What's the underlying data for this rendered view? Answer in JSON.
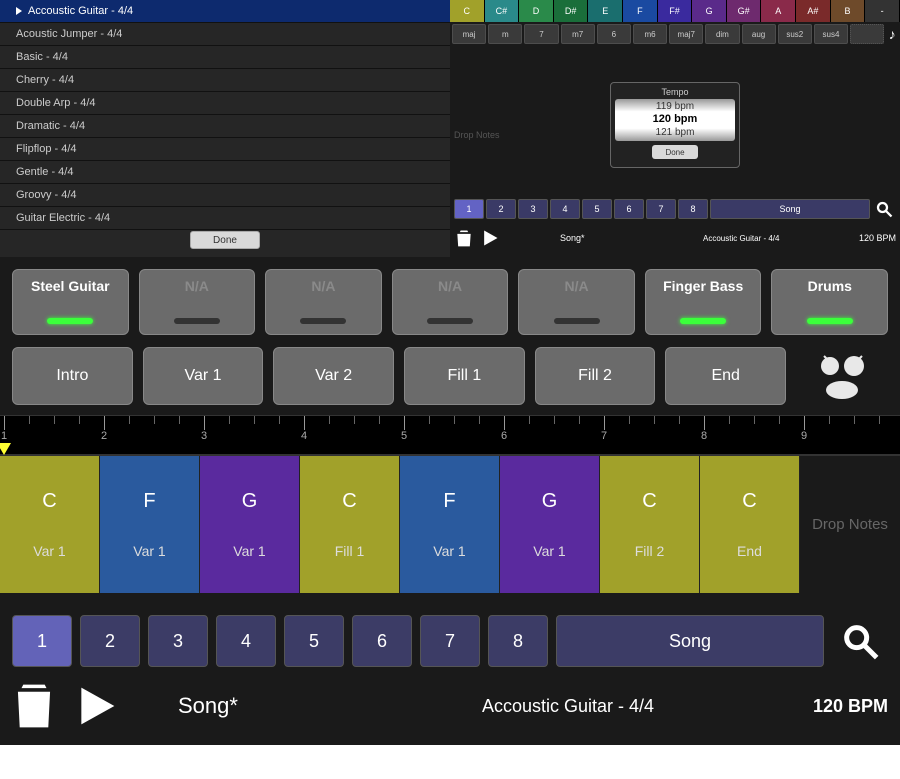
{
  "styles": {
    "items": [
      "Accoustic Guitar - 4/4",
      "Acoustic Jumper - 4/4",
      "Basic - 4/4",
      "Cherry - 4/4",
      "Double Arp - 4/4",
      "Dramatic - 4/4",
      "Flipflop - 4/4",
      "Gentle - 4/4",
      "Groovy - 4/4",
      "Guitar Electric - 4/4"
    ],
    "selected_index": 0,
    "done": "Done"
  },
  "keys": {
    "notes": [
      "C",
      "C#",
      "D",
      "D#",
      "E",
      "F",
      "F#",
      "G",
      "G#",
      "A",
      "A#",
      "B",
      "-"
    ],
    "note_colors": [
      "#a1a12a",
      "#2a8a8a",
      "#2a8a4a",
      "#1a6e3a",
      "#1a6e6e",
      "#1a4aa1",
      "#3a2a9e",
      "#5a2a8a",
      "#6e2a6e",
      "#8a2a4a",
      "#7a2a2a",
      "#6e4a2a",
      "#333"
    ],
    "chord_btns": [
      "maj",
      "m",
      "7",
      "m7",
      "6",
      "m6",
      "maj7",
      "dim",
      "aug",
      "sus2",
      "sus4"
    ]
  },
  "tempo": {
    "title": "Tempo",
    "prev": "119 bpm",
    "curr": "120 bpm",
    "next": "121 bpm",
    "done": "Done"
  },
  "drop_mini": "Drop Notes",
  "seq_mini": {
    "buttons": [
      "1",
      "2",
      "3",
      "4",
      "5",
      "6",
      "7",
      "8"
    ],
    "song": "Song"
  },
  "status_mini": {
    "song": "Song*",
    "style": "Accoustic Guitar - 4/4",
    "bpm": "120 BPM"
  },
  "instruments": [
    {
      "label": "Steel Guitar",
      "active": true
    },
    {
      "label": "N/A",
      "na": true
    },
    {
      "label": "N/A",
      "na": true
    },
    {
      "label": "N/A",
      "na": true
    },
    {
      "label": "N/A",
      "na": true
    },
    {
      "label": "Finger Bass",
      "active": true
    },
    {
      "label": "Drums",
      "active": true
    }
  ],
  "sections": [
    "Intro",
    "Var 1",
    "Var 2",
    "Fill 1",
    "Fill 2",
    "End"
  ],
  "ruler": [
    "1",
    "2",
    "3",
    "4",
    "5",
    "6",
    "7",
    "8",
    "9"
  ],
  "chords": [
    {
      "note": "C",
      "var": "Var 1",
      "color": "y"
    },
    {
      "note": "F",
      "var": "Var 1",
      "color": "b"
    },
    {
      "note": "G",
      "var": "Var 1",
      "color": "p"
    },
    {
      "note": "C",
      "var": "Fill 1",
      "color": "y"
    },
    {
      "note": "F",
      "var": "Var 1",
      "color": "b"
    },
    {
      "note": "G",
      "var": "Var 1",
      "color": "p"
    },
    {
      "note": "C",
      "var": "Fill 2",
      "color": "y"
    },
    {
      "note": "C",
      "var": "End",
      "color": "y"
    }
  ],
  "drop_label": "Drop Notes",
  "seq": {
    "buttons": [
      "1",
      "2",
      "3",
      "4",
      "5",
      "6",
      "7",
      "8"
    ],
    "song": "Song",
    "selected": 0
  },
  "status": {
    "song": "Song*",
    "style": "Accoustic Guitar - 4/4",
    "bpm": "120 BPM"
  }
}
